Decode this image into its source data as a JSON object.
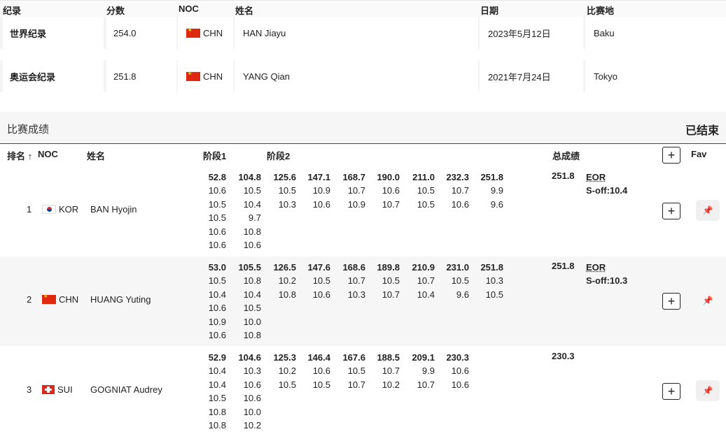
{
  "records": {
    "headers": {
      "record": "纪录",
      "score": "分数",
      "noc": "NOC",
      "name": "姓名",
      "date": "日期",
      "venue": "比赛地"
    },
    "rows": [
      {
        "type": "世界纪录",
        "score": "254.0",
        "noc": "CHN",
        "name": "HAN Jiayu",
        "date": "2023年5月12日",
        "venue": "Baku"
      },
      {
        "type": "奥运会纪录",
        "score": "251.8",
        "noc": "CHN",
        "name": "YANG Qian",
        "date": "2021年7月24日",
        "venue": "Tokyo"
      }
    ]
  },
  "results": {
    "title": "比赛成绩",
    "status": "已结束",
    "headers": {
      "rank": "排名 ↑",
      "noc": "NOC",
      "name": "姓名",
      "stage1": "阶段1",
      "stage2": "阶段2",
      "total": "总成绩",
      "fav": "Fav"
    },
    "add_label": "+",
    "pin_icon": "📌",
    "athletes": [
      {
        "rank": "1",
        "noc": "KOR",
        "flag": "kor",
        "name": "BAN Hyojin",
        "total": "251.8",
        "eor": "EOR",
        "soff": "S-off:10.4",
        "series": [
          [
            "52.8",
            "10.6",
            "10.5",
            "10.5",
            "10.6",
            "10.6"
          ],
          [
            "104.8",
            "10.5",
            "10.4",
            "9.7",
            "10.8",
            "10.6"
          ],
          [
            "125.6",
            "10.5",
            "10.3"
          ],
          [
            "147.1",
            "10.9",
            "10.6"
          ],
          [
            "168.7",
            "10.7",
            "10.9"
          ],
          [
            "190.0",
            "10.6",
            "10.7"
          ],
          [
            "211.0",
            "10.5",
            "10.5"
          ],
          [
            "232.3",
            "10.7",
            "10.6"
          ],
          [
            "251.8",
            "9.9",
            "9.6"
          ]
        ]
      },
      {
        "rank": "2",
        "noc": "CHN",
        "flag": "chn",
        "name": "HUANG Yuting",
        "total": "251.8",
        "eor": "EOR",
        "soff": "S-off:10.3",
        "series": [
          [
            "53.0",
            "10.5",
            "10.4",
            "10.6",
            "10.9",
            "10.6"
          ],
          [
            "105.5",
            "10.8",
            "10.4",
            "10.5",
            "10.0",
            "10.8"
          ],
          [
            "126.5",
            "10.2",
            "10.8"
          ],
          [
            "147.6",
            "10.5",
            "10.6"
          ],
          [
            "168.6",
            "10.7",
            "10.3"
          ],
          [
            "189.8",
            "10.5",
            "10.7"
          ],
          [
            "210.9",
            "10.7",
            "10.4"
          ],
          [
            "231.0",
            "10.5",
            "9.6"
          ],
          [
            "251.8",
            "10.3",
            "10.5"
          ]
        ]
      },
      {
        "rank": "3",
        "noc": "SUI",
        "flag": "sui",
        "name": "GOGNIAT Audrey",
        "total": "230.3",
        "eor": "",
        "soff": "",
        "series": [
          [
            "52.9",
            "10.4",
            "10.4",
            "10.5",
            "10.8",
            "10.8"
          ],
          [
            "104.6",
            "10.3",
            "10.6",
            "10.6",
            "10.0",
            "10.2"
          ],
          [
            "125.3",
            "10.2",
            "10.5"
          ],
          [
            "146.4",
            "10.6",
            "10.5"
          ],
          [
            "167.6",
            "10.5",
            "10.7"
          ],
          [
            "188.5",
            "10.7",
            "10.2"
          ],
          [
            "209.1",
            "9.9",
            "10.7"
          ],
          [
            "230.3",
            "10.6",
            "10.6"
          ]
        ]
      }
    ]
  }
}
